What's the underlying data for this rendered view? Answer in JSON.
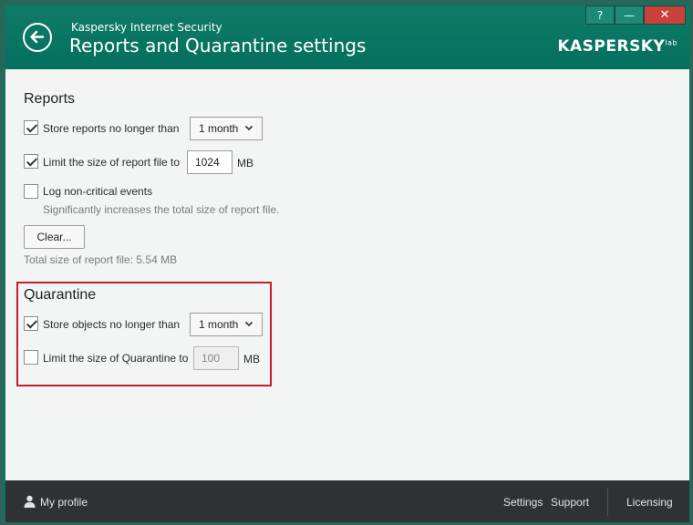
{
  "window": {
    "app_name": "Kaspersky Internet Security",
    "title": "Reports and Quarantine settings",
    "logo": "KASPERSKY",
    "logo_suffix": "lab",
    "help_label": "?",
    "minimize_label": "—",
    "close_label": "✕"
  },
  "reports": {
    "title": "Reports",
    "store_reports": {
      "label": "Store reports no longer than",
      "checked": true,
      "value": "1 month"
    },
    "limit_size": {
      "label": "Limit the size of report file to",
      "checked": true,
      "value": "1024",
      "unit": "MB"
    },
    "log_noncritical": {
      "label": "Log non-critical events",
      "checked": false,
      "hint": "Significantly increases the total size of report file."
    },
    "clear_label": "Clear...",
    "total_size": "Total size of report file: 5.54 MB"
  },
  "quarantine": {
    "title": "Quarantine",
    "store_objects": {
      "label": "Store objects no longer than",
      "checked": true,
      "value": "1 month"
    },
    "limit_size": {
      "label": "Limit the size of Quarantine to",
      "checked": false,
      "value": "100",
      "unit": "MB"
    }
  },
  "footer": {
    "profile": "My profile",
    "settings": "Settings",
    "support": "Support",
    "licensing": "Licensing"
  },
  "colors": {
    "header": "#0d7a66",
    "highlight": "#c51d2a",
    "footer": "#2f3233",
    "close": "#c9413a"
  }
}
